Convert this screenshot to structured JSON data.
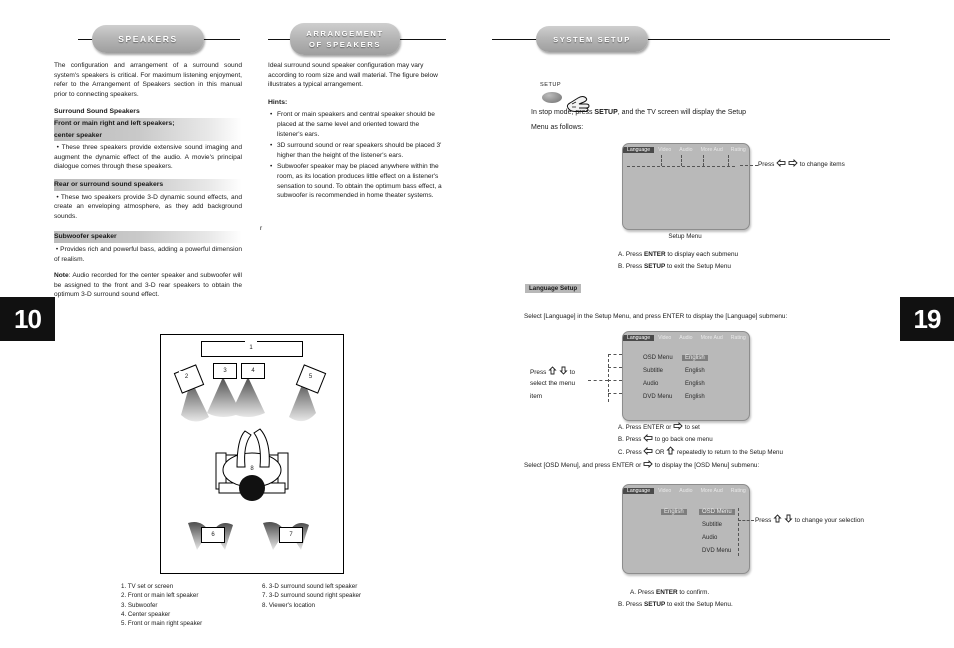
{
  "left_page": {
    "page_number": "10",
    "banners": [
      {
        "title": "SPEAKERS"
      },
      {
        "title_line1": "ARRANGEMENT",
        "title_line2": "OF SPEAKERS"
      }
    ],
    "column1": {
      "intro": "The configuration and arrangement of a surround sound system's speakers is critical. For maximum listening enjoyment, refer to the Arrangement of Speakers section in this manual prior to connecting speakers.",
      "heading_surround": "Surround Sound Speakers",
      "heading_front_line1": "Front or main right and left speakers;",
      "heading_front_line2": "center speaker",
      "body_front": "These three speakers provide extensive sound imaging and augment the dynamic effect of the audio. A movie's principal dialogue comes through these speakers.",
      "heading_rear": "Rear or surround sound speakers",
      "body_rear": "These two speakers provide 3-D dynamic sound effects,  and create an enveloping atmosphere, as they add background sounds.",
      "heading_subwoofer": "Subwoofer speaker",
      "body_subwoofer": "Provides rich and powerful bass, adding a powerful dimension of realism.",
      "note_label": "Note",
      "note_text": ": Audio recorded for the center speaker and subwoofer will be assigned to the front  and 3-D rear speakers to obtain the  optimum 3-D surround sound effect."
    },
    "column2": {
      "intro": "Ideal surround sound speaker configuration may vary according to room size and wall material. The figure below illustrates a typical arrangement.",
      "hints_label": "Hints:",
      "hints": [
        "Front or main speakers and central  speaker should be placed at the same level and oriented toward the listener's ears.",
        "3D surround sound or rear speakers  should be placed 3' higher than the height of the listener's ears.",
        "Subwoofer speaker may be placed anywhere within the room, as its location produces little effect on a listener's sensation to  sound. To obtain the optimum bass effect, a  subwoofer is recommended in home theater systems."
      ],
      "stray_char": "r"
    },
    "diagram": {
      "markers": [
        "1",
        "2",
        "3",
        "4",
        "5",
        "6",
        "7",
        "8"
      ],
      "legend_left": [
        "1. TV set or screen",
        "2. Front or main left speaker",
        "3. Subwoofer",
        "4. Center speaker",
        "5. Front or main right speaker"
      ],
      "legend_right": [
        "6. 3-D surround sound left speaker",
        "7. 3-D surround sound right speaker",
        "8. Viewer's location"
      ]
    }
  },
  "right_page": {
    "page_number": "19",
    "banner_title": "SYSTEM SETUP",
    "setup_button_label": "SETUP",
    "intro_line1_a": "In stop mode, press ",
    "intro_line1_b": "SETUP",
    "intro_line1_c": ", and the TV screen will display the Setup",
    "intro_line2": "Menu as follows:",
    "osd_tabs": [
      "Language",
      "Video",
      "Audio",
      "More Aud",
      "Rating"
    ],
    "setup_menu": {
      "caption": "Setup Menu",
      "hint_right": "Press          to change items",
      "hint_right_prefix": "Press ",
      "hint_right_suffix": " to change items",
      "steps": [
        {
          "letter": "A. Press ",
          "bold": "ENTER",
          "rest": " to display each submenu"
        },
        {
          "letter": "B. Press ",
          "bold": "SETUP",
          "rest": " to exit the Setup Menu"
        }
      ]
    },
    "language_setup": {
      "section_label": "Language Setup",
      "intro": "Select [Language] in the Setup Menu, and press ENTER to display the [Language] submenu:",
      "hint_left_line1": "Press         to",
      "hint_left_line2": "select the menu",
      "hint_left_line3": "item",
      "rows": [
        {
          "name": "OSD Menu",
          "value": "English",
          "selected": true
        },
        {
          "name": "Subtitle",
          "value": "English",
          "selected": false
        },
        {
          "name": "Audio",
          "value": "English",
          "selected": false
        },
        {
          "name": "DVD Menu",
          "value": "English",
          "selected": false
        }
      ],
      "steps": [
        "A.  Press ENTER or       to set",
        "B.  Press       to go back one menu",
        "C.  Press       OR        repeatedly to return to the Setup Menu"
      ]
    },
    "osd_menu": {
      "intro": "Select [OSD Menu], and press ENTER or       to display the [OSD Menu] submenu:",
      "selected_value": "English",
      "rows": [
        {
          "name": "OSD Menu",
          "selected": true
        },
        {
          "name": "Subtitle",
          "selected": false
        },
        {
          "name": "Audio",
          "selected": false
        },
        {
          "name": "DVD Menu",
          "selected": false
        }
      ],
      "hint_right": "Press         to change your selection",
      "steps": [
        {
          "letter": "A.  Press ",
          "bold": "ENTER",
          "rest": " to confirm."
        },
        {
          "letter": "B.  Press ",
          "bold": "SETUP",
          "rest": " to exit the Setup Menu."
        }
      ]
    }
  },
  "colors": {
    "pill_gray": "#b6b6b6",
    "osd_bg": "#b9b9b9",
    "osd_tab_active": "#4a4a4a",
    "osd_select": "#7e7e7e",
    "page_badge": "#111111"
  }
}
